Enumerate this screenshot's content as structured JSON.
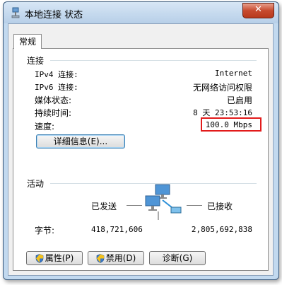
{
  "window": {
    "title": "本地连接 状态",
    "close_glyph": "✕"
  },
  "tabs": [
    {
      "label": "常规"
    }
  ],
  "connection": {
    "group_label": "连接",
    "rows": [
      {
        "label": "IPv4 连接:",
        "value": "Internet"
      },
      {
        "label": "IPv6 连接:",
        "value": "无网络访问权限"
      },
      {
        "label": "媒体状态:",
        "value": "已启用"
      },
      {
        "label": "持续时间:",
        "value": "8 天 23:53:16"
      },
      {
        "label": "速度:",
        "value": "100.0 Mbps"
      }
    ],
    "details_button": "详细信息(E)..."
  },
  "activity": {
    "group_label": "活动",
    "sent_label": "已发送",
    "received_label": "已接收",
    "bytes_label": "字节:",
    "bytes_sent": "418,721,606",
    "bytes_received": "2,805,692,838"
  },
  "buttons": {
    "properties": "属性(P)",
    "disable": "禁用(D)",
    "diagnose": "诊断(G)"
  },
  "icons": {
    "title": "network-connection-icon",
    "activity": "network-computers-icon",
    "shield": "uac-shield-icon"
  },
  "colors": {
    "highlight": "#e21b1b",
    "close": "#c74a2e"
  }
}
